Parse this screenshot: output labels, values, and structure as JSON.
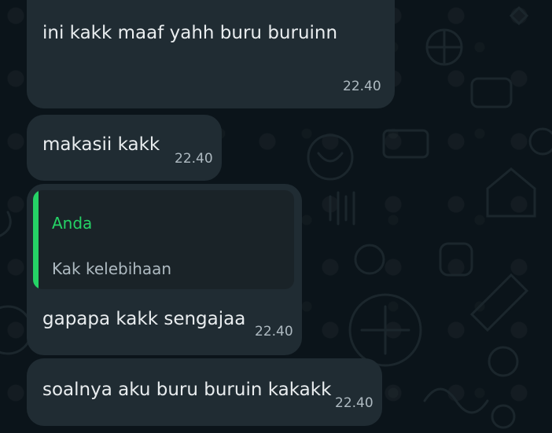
{
  "messages": [
    {
      "text": "ini kakk maaf yahh buru buruinn",
      "time": "22.40"
    },
    {
      "text": "makasii kakk",
      "time": "22.40"
    },
    {
      "quote_author": "Anda",
      "quote_text": "Kak kelebihaan",
      "text": "gapapa kakk sengajaa",
      "time": "22.40"
    },
    {
      "text": "soalnya aku buru buruin kakakk",
      "time": "22.40"
    }
  ],
  "colors": {
    "background": "#0b141a",
    "bubble": "#202c33",
    "quote_accent": "#25d366"
  }
}
